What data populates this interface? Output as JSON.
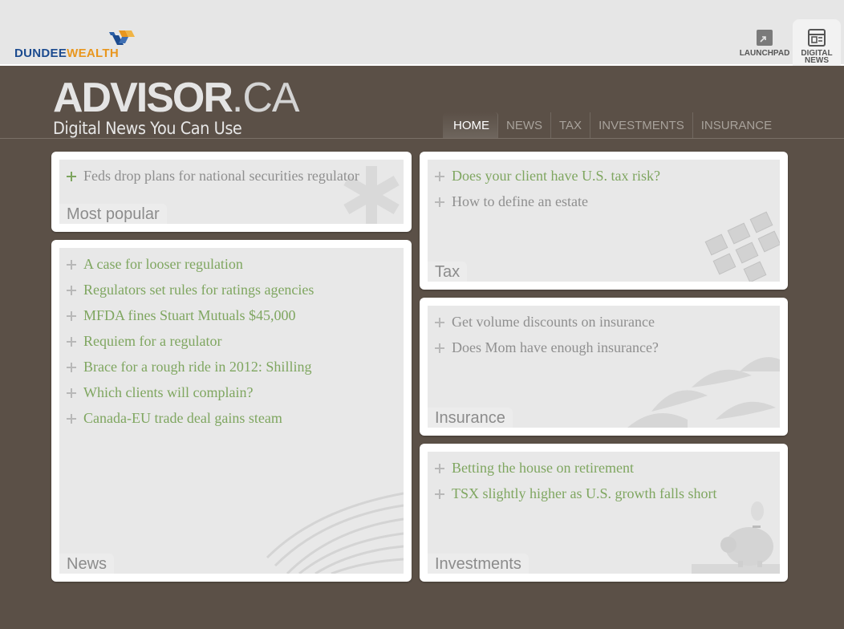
{
  "topbar": {
    "logo": {
      "part1": "DUNDEE",
      "part2": "WEALTH"
    },
    "launchpad_label": "LAUNCHPAD",
    "digital_news_label_1": "DIGITAL",
    "digital_news_label_2": "NEWS"
  },
  "brand": {
    "name_main": "ADVISOR",
    "name_suffix": ".CA",
    "tagline": "Digital News You Can Use"
  },
  "nav": {
    "items": [
      "HOME",
      "NEWS",
      "TAX",
      "INVESTMENTS",
      "INSURANCE"
    ],
    "active": "HOME"
  },
  "panels": {
    "most_popular": {
      "title": "Most popular",
      "items": [
        "Feds drop plans for national securities regulator"
      ]
    },
    "news": {
      "title": "News",
      "items": [
        "A case for looser regulation",
        "Regulators set rules for ratings agencies",
        "MFDA fines Stuart Mutuals $45,000",
        "Requiem for a regulator",
        "Brace for a rough ride in 2012: Shilling",
        "Which clients will complain?",
        "Canada-EU trade deal gains steam"
      ]
    },
    "tax": {
      "title": "Tax",
      "items": [
        "Does your client have U.S. tax risk?",
        "How to define an estate"
      ]
    },
    "insurance": {
      "title": "Insurance",
      "items": [
        "Get volume discounts on insurance",
        "Does Mom have enough insurance?"
      ]
    },
    "investments": {
      "title": "Investments",
      "items": [
        "Betting the house on retirement",
        "TSX slightly higher as U.S. growth falls short"
      ]
    }
  },
  "colors": {
    "background": "#5b5047",
    "link_green": "#7fa660",
    "link_grey": "#8f8f8f",
    "panel": "#e8e8e8"
  }
}
